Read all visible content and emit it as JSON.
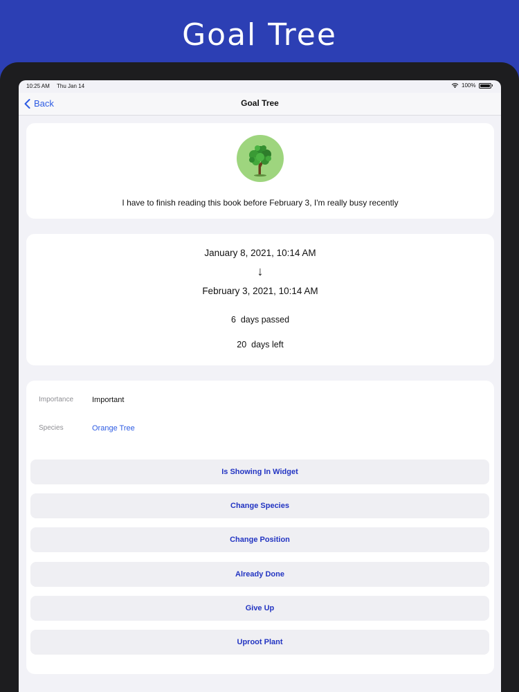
{
  "banner": {
    "title": "Goal Tree"
  },
  "status_bar": {
    "time": "10:25 AM",
    "date": "Thu Jan 14",
    "battery": "100%"
  },
  "navbar": {
    "back_label": "Back",
    "title": "Goal Tree"
  },
  "goal": {
    "icon": "tree-icon",
    "text": "I have to finish reading this book before February 3, I'm really busy recently"
  },
  "timeline": {
    "start": "January 8, 2021, 10:14 AM",
    "arrow": "↓",
    "end": "February 3, 2021, 10:14 AM",
    "days_passed": "6  days passed",
    "days_left": "20  days left"
  },
  "details": {
    "importance_label": "Importance",
    "importance_value": "Important",
    "species_label": "Species",
    "species_value": "Orange Tree"
  },
  "actions": [
    {
      "label": "Is Showing In Widget"
    },
    {
      "label": "Change Species"
    },
    {
      "label": "Change Position"
    },
    {
      "label": "Already Done"
    },
    {
      "label": "Give Up"
    },
    {
      "label": "Uproot Plant"
    }
  ],
  "colors": {
    "banner": "#2c3fb4",
    "accent": "#2d5be3",
    "button_text": "#2234c2",
    "tree_circle": "#9ed57e"
  }
}
